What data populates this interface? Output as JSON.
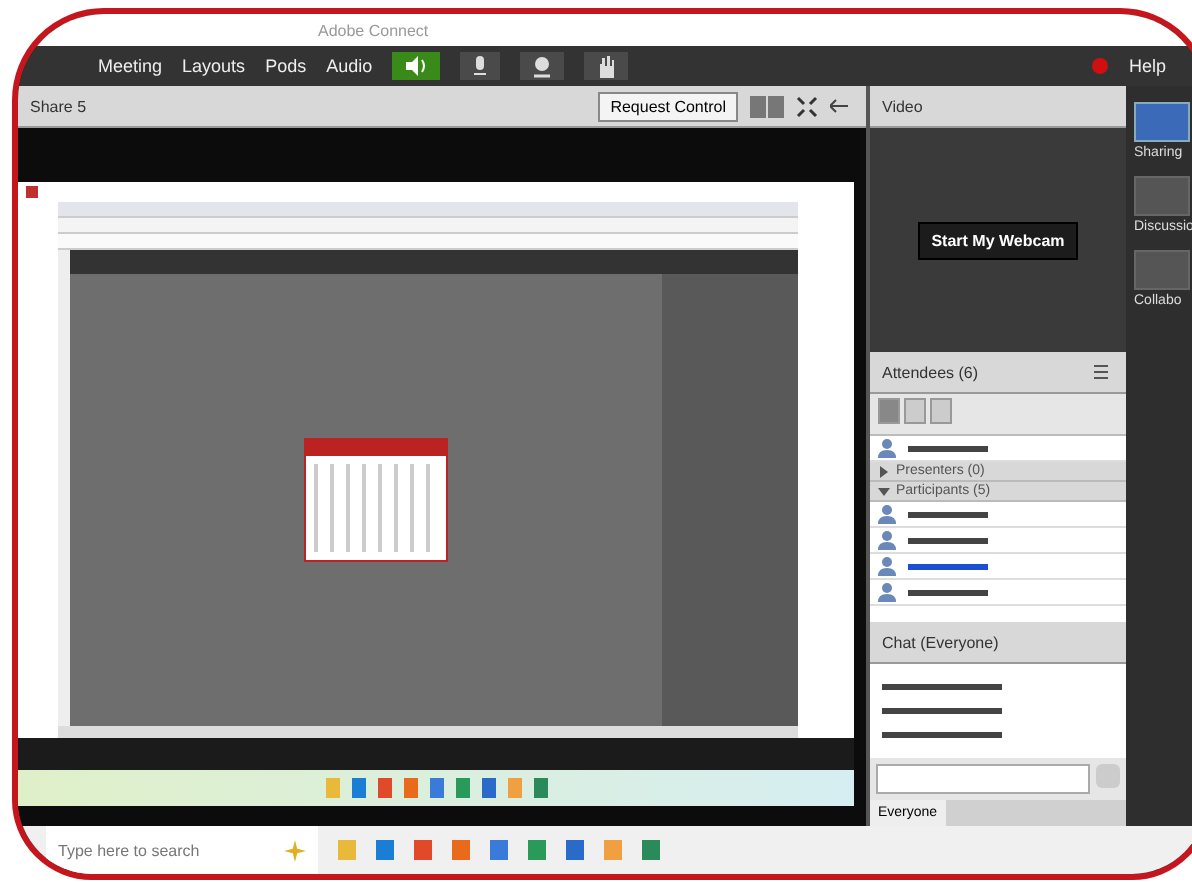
{
  "window": {
    "title": "Adobe Connect"
  },
  "menu": [
    {
      "label": "Meeting"
    },
    {
      "label": "Layouts"
    },
    {
      "label": "Pods"
    },
    {
      "label": "Audio"
    }
  ],
  "audio": {
    "speaker_on": true
  },
  "help": "Help",
  "share_pod": {
    "title": "Share 5",
    "request_button": "Request Control"
  },
  "video_pod": {
    "title": "Video",
    "button": "Start My Webcam"
  },
  "layouts": [
    {
      "label": "Sharing",
      "selected": true
    },
    {
      "label": "Discussio",
      "selected": false
    },
    {
      "label": "Collabo",
      "selected": false
    }
  ],
  "attendees": {
    "title": "Attendees (6)",
    "hosts": [
      {
        "kind": "blurred",
        "self": false
      }
    ],
    "groups": [
      {
        "label": "Presenters (0)",
        "expanded": false
      },
      {
        "label": "Participants (5)",
        "expanded": true,
        "members": [
          {
            "kind": "blurred",
            "self": false
          },
          {
            "kind": "blurred",
            "self": false
          },
          {
            "kind": "blurred",
            "self": true
          },
          {
            "kind": "blurred",
            "self": false
          }
        ]
      }
    ]
  },
  "chat": {
    "title": "Chat (Everyone)",
    "messages": [
      {
        "kind": "blurred"
      },
      {
        "kind": "blurred"
      },
      {
        "kind": "blurred"
      }
    ],
    "tab": "Everyone"
  },
  "taskbar": {
    "search_placeholder": "Type here to search"
  }
}
